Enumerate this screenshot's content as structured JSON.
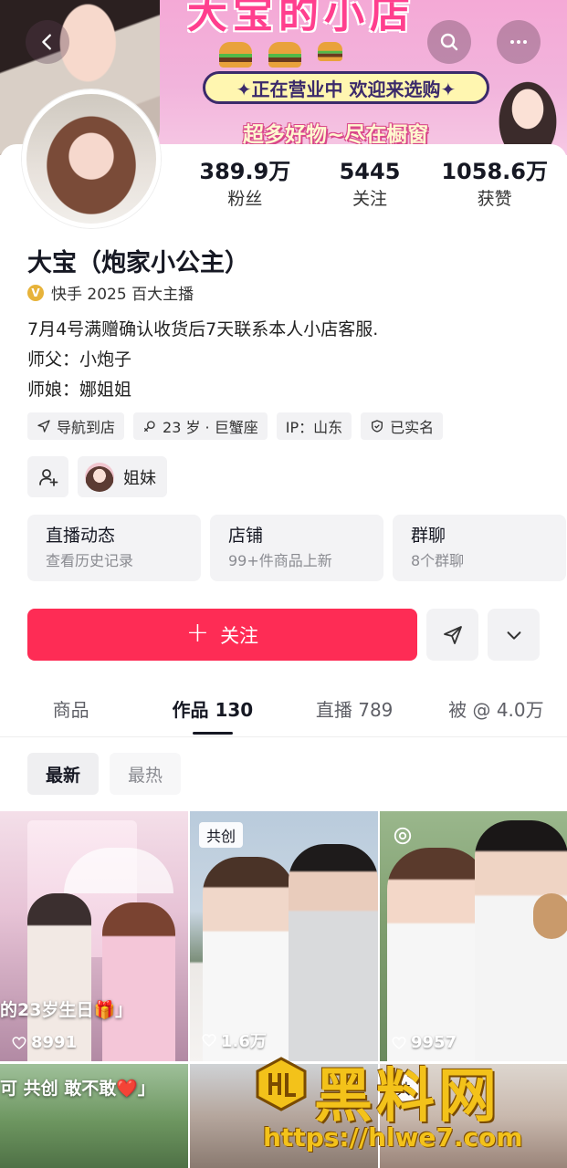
{
  "banner": {
    "big_title": "大宝的小店",
    "pill_text": "✦正在营业中 欢迎来选购✦",
    "slogan": "超多好物~尽在橱窗"
  },
  "profile": {
    "stats": [
      {
        "value": "389.9万",
        "label": "粉丝"
      },
      {
        "value": "5445",
        "label": "关注"
      },
      {
        "value": "1058.6万",
        "label": "获赞"
      }
    ],
    "name": "大宝（炮家小公主）",
    "cert_icon_text": "V",
    "certification": "快手 2025 百大主播",
    "bio": [
      "7月4号满赠确认收货后7天联系本人小店客服.",
      "师父：小炮子",
      "师娘：娜姐姐"
    ],
    "tags": [
      {
        "icon": "navigation-icon",
        "label": "导航到店"
      },
      {
        "icon": "gender-icon",
        "label": "23 岁 · 巨蟹座"
      },
      {
        "icon": "",
        "label": "IP：山东"
      },
      {
        "icon": "verified-shield-icon",
        "label": "已实名"
      }
    ],
    "sister_label": "姐妹",
    "info_cards": [
      {
        "title": "直播动态",
        "sub": "查看历史记录"
      },
      {
        "title": "店铺",
        "sub": "99+件商品上新"
      },
      {
        "title": "群聊",
        "sub": "8个群聊"
      }
    ],
    "follow_label": "关注",
    "follow_plus": "+",
    "accent_color": "#fe2c55"
  },
  "tabs": [
    {
      "label": "商品"
    },
    {
      "label": "作品 130"
    },
    {
      "label": "直播 789"
    },
    {
      "label": "被 @ 4.0万"
    }
  ],
  "sort": {
    "newest": "最新",
    "hottest": "最热"
  },
  "grid": [
    {
      "caption": "的23岁生日🎁」",
      "badge": "",
      "likes": "8991"
    },
    {
      "caption": "",
      "badge": "共创",
      "likes": "1.6万"
    },
    {
      "caption": "",
      "badge": "",
      "likes": "9957"
    },
    {
      "caption": "可 共创 敢不敢❤️」",
      "badge": "",
      "likes": ""
    },
    {
      "caption": "",
      "badge": "",
      "likes": ""
    },
    {
      "caption": "",
      "badge": "共",
      "likes": ""
    }
  ],
  "watermark": {
    "title": "黑料网",
    "url": "https://hlwe7.com"
  }
}
